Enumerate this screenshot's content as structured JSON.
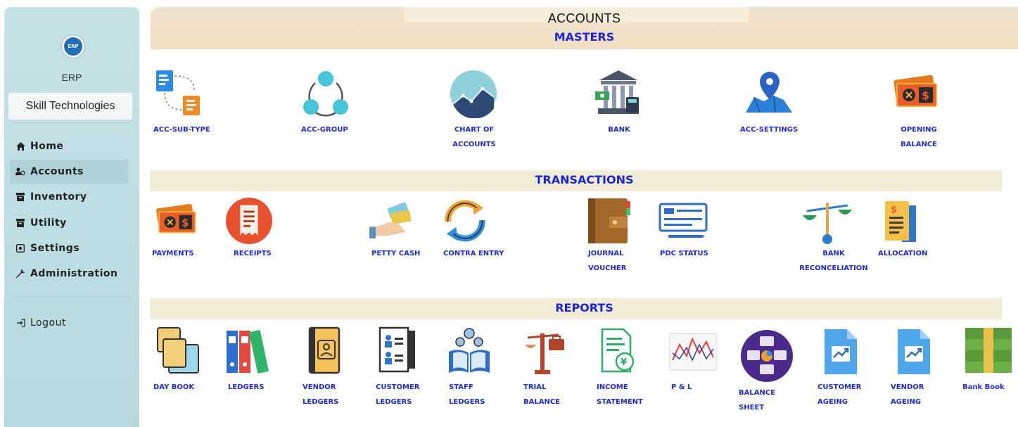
{
  "sidebar": {
    "logo_text": "ERP",
    "app_name": "ERP",
    "company": "Skill Technologies",
    "nav": [
      {
        "label": "Home",
        "icon": "home-icon"
      },
      {
        "label": "Accounts",
        "icon": "accounts-icon"
      },
      {
        "label": "Inventory",
        "icon": "inventory-icon"
      },
      {
        "label": "Utility",
        "icon": "utility-icon"
      },
      {
        "label": "Settings",
        "icon": "settings-icon"
      },
      {
        "label": "Administration",
        "icon": "wrench-icon"
      }
    ],
    "logout": "Logout",
    "active": "Accounts"
  },
  "page": {
    "title": "ACCOUNTS",
    "sections": {
      "masters": "MASTERS",
      "transactions": "TRANSACTIONS",
      "reports": "REPORTS"
    }
  },
  "masters": [
    {
      "label": "ACC-SUB-TYPE",
      "icon": "flowchart-icon"
    },
    {
      "label": "ACC-GROUP",
      "icon": "group-cycle-icon"
    },
    {
      "label": "CHART OF\nACCOUNTS",
      "icon": "area-chart-icon"
    },
    {
      "label": "BANK",
      "icon": "bank-icon"
    },
    {
      "label": "ACC-SETTINGS",
      "icon": "map-pin-icon"
    },
    {
      "label": "OPENING\nBALANCE",
      "icon": "money-ticket-icon"
    }
  ],
  "transactions": [
    {
      "label": "PAYMENTS",
      "icon": "money-ticket-icon"
    },
    {
      "label": "RECEIPTS",
      "icon": "receipt-icon"
    },
    {
      "label": "PETTY CASH",
      "icon": "hand-cash-icon"
    },
    {
      "label": "CONTRA ENTRY",
      "icon": "refresh-arrows-icon"
    },
    {
      "label": "JOURNAL\nVOUCHER",
      "icon": "wallet-icon"
    },
    {
      "label": "PDC STATUS",
      "icon": "cheque-icon"
    },
    {
      "label": "BANK\nRECONCELIATION",
      "icon": "balance-scale-icon"
    },
    {
      "label": "ALLOCATION",
      "icon": "document-icon"
    }
  ],
  "reports": [
    {
      "label": "DAY BOOK",
      "icon": "books-icon"
    },
    {
      "label": "LEDGERS",
      "icon": "binders-icon"
    },
    {
      "label": "VENDOR\nLEDGERS",
      "icon": "contact-book-icon"
    },
    {
      "label": "CUSTOMER\nLEDGERS",
      "icon": "customer-file-icon"
    },
    {
      "label": "STAFF\nLEDGERS",
      "icon": "staff-book-icon"
    },
    {
      "label": "TRIAL\nBALANCE",
      "icon": "scale-briefcase-icon"
    },
    {
      "label": "INCOME\nSTATEMENT",
      "icon": "income-doc-icon"
    },
    {
      "label": "P & L",
      "icon": "line-graph-icon"
    },
    {
      "label": "BALANCE\nSHEET",
      "icon": "balance-sheet-icon"
    },
    {
      "label": "CUSTOMER\nAGEING",
      "icon": "trend-doc-icon"
    },
    {
      "label": "VENDOR\nAGEING",
      "icon": "trend-doc-icon"
    },
    {
      "label": "Bank Book",
      "icon": "cash-stack-icon"
    }
  ],
  "colors": {
    "label_blue": "#1f2bd6",
    "section_blue": "#1a25e0",
    "sidebar_bg": "#bcdde2",
    "header_bg": "#f3dfc4",
    "section_band": "#f1ecd5"
  }
}
